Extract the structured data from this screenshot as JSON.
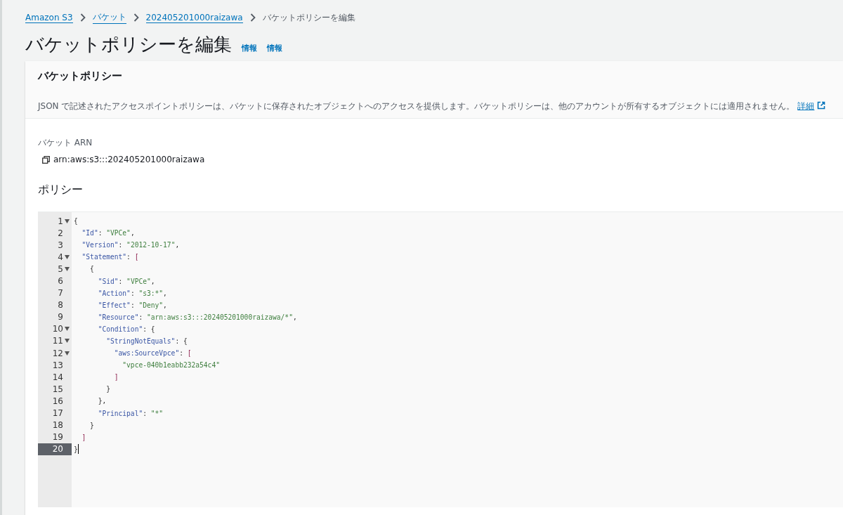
{
  "breadcrumbs": [
    {
      "label": "Amazon S3",
      "kind": "link"
    },
    {
      "label": "バケット",
      "kind": "link"
    },
    {
      "label": "202405201000raizawa",
      "kind": "link"
    },
    {
      "label": "バケットポリシーを編集",
      "kind": "current"
    }
  ],
  "page_title": "バケットポリシーを編集",
  "info_links": [
    "情報",
    "情報"
  ],
  "card": {
    "title": "バケットポリシー",
    "description": "JSON で記述されたアクセスポイントポリシーは、バケットに保存されたオブジェクトへのアクセスを提供します。バケットポリシーは、他のアカウントが所有するオブジェクトには適用されません。",
    "details_link": "詳細",
    "arn_label": "バケット ARN",
    "arn_value": "arn:aws:s3:::202405201000raizawa",
    "policy_label": "ポリシー",
    "editor": {
      "lines": [
        {
          "number": "1",
          "fold": true,
          "active": false,
          "tokens": [
            {
              "kind": "punct",
              "text": "{"
            }
          ]
        },
        {
          "number": "2",
          "fold": false,
          "active": false,
          "tokens": [
            {
              "kind": "key",
              "text": "  \"Id\""
            },
            {
              "kind": "punct",
              "text": ": "
            },
            {
              "kind": "string",
              "text": "\"VPCe\""
            },
            {
              "kind": "punct",
              "text": ","
            }
          ]
        },
        {
          "number": "3",
          "fold": false,
          "active": false,
          "tokens": [
            {
              "kind": "key",
              "text": "  \"Version\""
            },
            {
              "kind": "punct",
              "text": ": "
            },
            {
              "kind": "string",
              "text": "\"2012-10-17\""
            },
            {
              "kind": "punct",
              "text": ","
            }
          ]
        },
        {
          "number": "4",
          "fold": true,
          "active": false,
          "tokens": [
            {
              "kind": "key",
              "text": "  \"Statement\""
            },
            {
              "kind": "punct",
              "text": ": "
            },
            {
              "kind": "bracket",
              "text": "["
            }
          ]
        },
        {
          "number": "5",
          "fold": true,
          "active": false,
          "tokens": [
            {
              "kind": "punct",
              "text": "    {"
            }
          ]
        },
        {
          "number": "6",
          "fold": false,
          "active": false,
          "tokens": [
            {
              "kind": "key",
              "text": "      \"Sid\""
            },
            {
              "kind": "punct",
              "text": ": "
            },
            {
              "kind": "string",
              "text": "\"VPCe\""
            },
            {
              "kind": "punct",
              "text": ","
            }
          ]
        },
        {
          "number": "7",
          "fold": false,
          "active": false,
          "tokens": [
            {
              "kind": "key",
              "text": "      \"Action\""
            },
            {
              "kind": "punct",
              "text": ": "
            },
            {
              "kind": "string",
              "text": "\"s3:*\""
            },
            {
              "kind": "punct",
              "text": ","
            }
          ]
        },
        {
          "number": "8",
          "fold": false,
          "active": false,
          "tokens": [
            {
              "kind": "key",
              "text": "      \"Effect\""
            },
            {
              "kind": "punct",
              "text": ": "
            },
            {
              "kind": "string",
              "text": "\"Deny\""
            },
            {
              "kind": "punct",
              "text": ","
            }
          ]
        },
        {
          "number": "9",
          "fold": false,
          "active": false,
          "tokens": [
            {
              "kind": "key",
              "text": "      \"Resource\""
            },
            {
              "kind": "punct",
              "text": ": "
            },
            {
              "kind": "string",
              "text": "\"arn:aws:s3:::202405201000raizawa/*\""
            },
            {
              "kind": "punct",
              "text": ","
            }
          ]
        },
        {
          "number": "10",
          "fold": true,
          "active": false,
          "tokens": [
            {
              "kind": "key",
              "text": "      \"Condition\""
            },
            {
              "kind": "punct",
              "text": ": {"
            }
          ]
        },
        {
          "number": "11",
          "fold": true,
          "active": false,
          "tokens": [
            {
              "kind": "key",
              "text": "        \"StringNotEquals\""
            },
            {
              "kind": "punct",
              "text": ": {"
            }
          ]
        },
        {
          "number": "12",
          "fold": true,
          "active": false,
          "tokens": [
            {
              "kind": "key",
              "text": "          \"aws:SourceVpce\""
            },
            {
              "kind": "punct",
              "text": ": "
            },
            {
              "kind": "bracket",
              "text": "["
            }
          ]
        },
        {
          "number": "13",
          "fold": false,
          "active": false,
          "tokens": [
            {
              "kind": "string",
              "text": "            \"vpce-040b1eabb232a54c4\""
            }
          ]
        },
        {
          "number": "14",
          "fold": false,
          "active": false,
          "tokens": [
            {
              "kind": "bracket",
              "text": "          ]"
            }
          ]
        },
        {
          "number": "15",
          "fold": false,
          "active": false,
          "tokens": [
            {
              "kind": "punct",
              "text": "        }"
            }
          ]
        },
        {
          "number": "16",
          "fold": false,
          "active": false,
          "tokens": [
            {
              "kind": "punct",
              "text": "      },"
            }
          ]
        },
        {
          "number": "17",
          "fold": false,
          "active": false,
          "tokens": [
            {
              "kind": "key",
              "text": "      \"Principal\""
            },
            {
              "kind": "punct",
              "text": ": "
            },
            {
              "kind": "string",
              "text": "\"*\""
            }
          ]
        },
        {
          "number": "18",
          "fold": false,
          "active": false,
          "tokens": [
            {
              "kind": "punct",
              "text": "    }"
            }
          ]
        },
        {
          "number": "19",
          "fold": false,
          "active": false,
          "tokens": [
            {
              "kind": "bracket",
              "text": "  ]"
            }
          ]
        },
        {
          "number": "20",
          "fold": false,
          "active": true,
          "tokens": [
            {
              "kind": "punct",
              "text": "}"
            }
          ]
        }
      ]
    }
  }
}
